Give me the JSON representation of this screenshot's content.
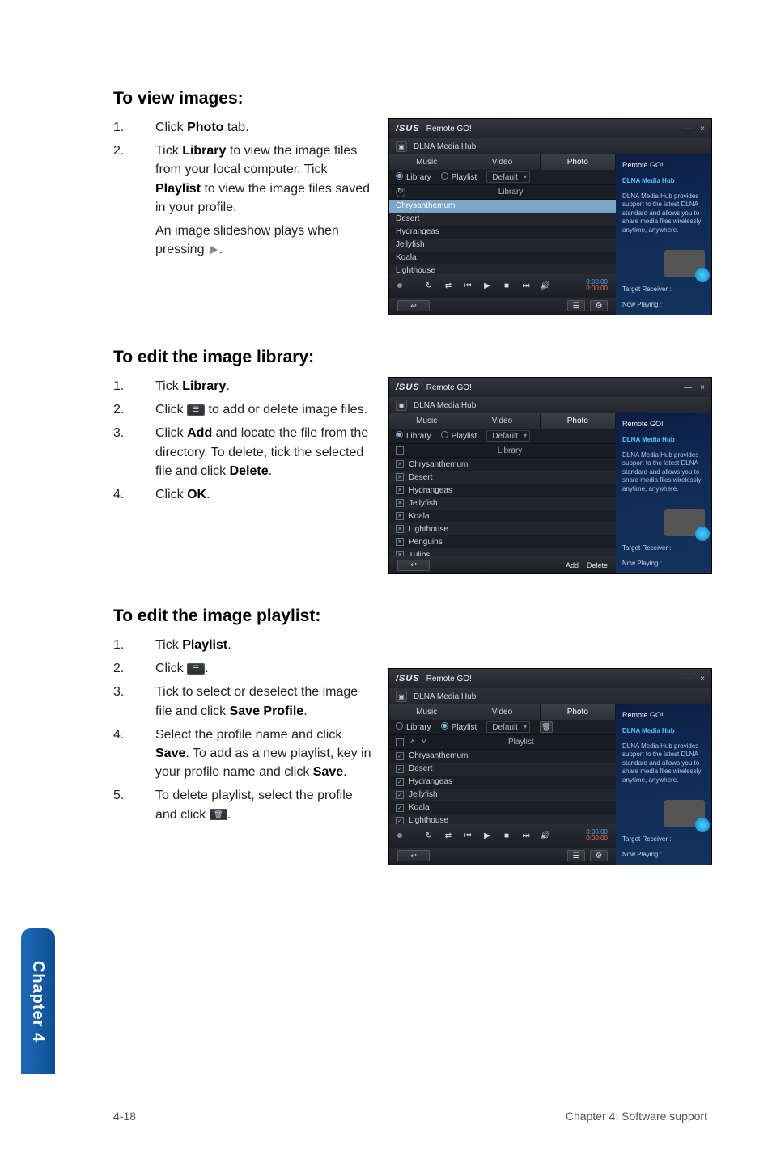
{
  "sideTab": "Chapter 4",
  "footer": {
    "left": "4-18",
    "right": "Chapter 4: Software support"
  },
  "s1": {
    "title": "To view images:",
    "steps": [
      {
        "n": "1.",
        "pre": "Click ",
        "b1": "Photo",
        "post": " tab."
      },
      {
        "n": "2.",
        "pre": "Tick ",
        "b1": "Library",
        "mid": " to view the image files from your local computer. Tick ",
        "b2": "Playlist",
        "post": " to view the image files saved in your profile."
      },
      {
        "n": "",
        "plain": "An image slideshow plays when pressing "
      }
    ]
  },
  "s2": {
    "title": "To edit the image library:",
    "steps": [
      {
        "n": "1.",
        "pre": "Tick ",
        "b1": "Library",
        "post": "."
      },
      {
        "n": "2.",
        "plain": "Click  to add or delete image files."
      },
      {
        "n": "3.",
        "pre": "Click ",
        "b1": "Add",
        "mid": " and locate the file from the directory. To delete, tick the selected file and click ",
        "b2": "Delete",
        "post": "."
      },
      {
        "n": "4.",
        "pre": "Click ",
        "b1": "OK",
        "post": "."
      }
    ]
  },
  "s3": {
    "title": "To edit the image playlist:",
    "steps": [
      {
        "n": "1.",
        "pre": "Tick ",
        "b1": "Playlist",
        "post": "."
      },
      {
        "n": "2.",
        "plain": "Click ."
      },
      {
        "n": "3.",
        "pre": "Tick to select or deselect the image file and click ",
        "b1": "Save Profile",
        "post": "."
      },
      {
        "n": "4.",
        "pre": "Select the profile name and click ",
        "b1": "Save",
        "mid": ". To add as a new playlist, key in your profile name and click ",
        "b2": "Save",
        "post": "."
      },
      {
        "n": "5.",
        "plain": "To delete playlist, select the profile and click ."
      }
    ]
  },
  "panel": {
    "brand": "/SUS",
    "title": "Remote GO!",
    "min": "—",
    "close": "×",
    "sub": "DLNA Media Hub",
    "rg_title": "Remote GO!",
    "rg_sub": "DLNA Media Hub",
    "rg_desc": "DLNA Media Hub provides support to the latest DLNA standard and allows you to share media files wirelessly anytime, anywhere.",
    "tgt": "Target Receiver :",
    "now": "Now Playing :",
    "tabs": {
      "music": "Music",
      "video": "Video",
      "photo": "Photo"
    },
    "filter": {
      "library": "Library",
      "playlist": "Playlist",
      "default": "Default"
    },
    "libbar": {
      "label": "Library",
      "plabel": "Playlist"
    },
    "list1": [
      "Chrysanthemum",
      "Desert",
      "Hydrangeas",
      "Jellyfish",
      "Koala",
      "Lighthouse"
    ],
    "list2": [
      "Chrysanthemum",
      "Desert",
      "Hydrangeas",
      "Jellyfish",
      "Koala",
      "Lighthouse",
      "Penguins",
      "Tulips"
    ],
    "list3": [
      "Chrysanthemum",
      "Desert",
      "Hydrangeas",
      "Jellyfish",
      "Koala",
      "Lighthouse"
    ],
    "player": {
      "t1": "0:00:00",
      "t2": "0:00:00"
    },
    "footer": {
      "back": "↩"
    },
    "addbar": {
      "add": "Add",
      "del": "Delete"
    }
  }
}
